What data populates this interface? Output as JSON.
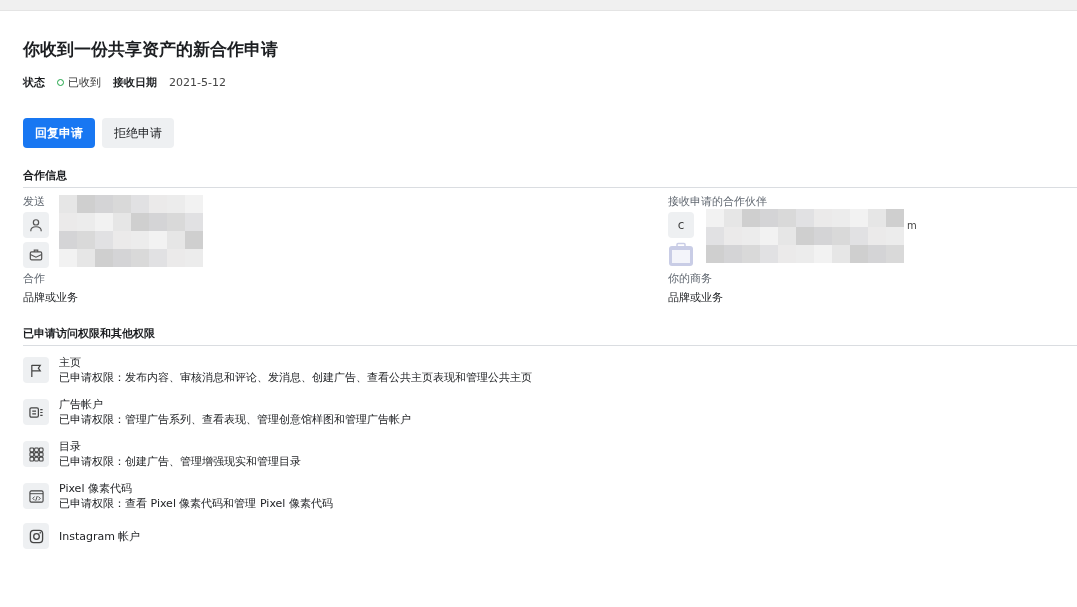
{
  "title": "你收到一份共享资产的新合作申请",
  "meta": {
    "status_label": "状态",
    "status_value": "已收到",
    "date_label": "接收日期",
    "date_value": "2021-5-12"
  },
  "buttons": [
    {
      "label": "回复申请",
      "kind": "primary"
    },
    {
      "label": "拒绝申请",
      "kind": "secondary"
    }
  ],
  "partner_info": {
    "heading": "合作信息",
    "columns": [
      {
        "label": "发送",
        "role_label": "合作",
        "role_value": "品牌或业务"
      },
      {
        "label": "接收申请的合作伙伴",
        "avatar_letter": "c",
        "email_tail": "m",
        "role_label": "你的商务",
        "role_value": "品牌或业务"
      }
    ]
  },
  "permissions": {
    "heading": "已申请访问权限和其他权限",
    "items": [
      {
        "name": "主页",
        "detail": "已申请权限：发布内容、审核消息和评论、发消息、创建广告、查看公共主页表现和管理公共主页"
      },
      {
        "name": "广告帐户",
        "detail": "已申请权限：管理广告系列、查看表现、管理创意馆样图和管理广告帐户"
      },
      {
        "name": "目录",
        "detail": "已申请权限：创建广告、管理增强现实和管理目录"
      },
      {
        "name": "Pixel 像素代码",
        "detail": "已申请权限：查看 Pixel 像素代码和管理 Pixel 像素代码"
      },
      {
        "name": "Instagram 帐户"
      }
    ]
  }
}
